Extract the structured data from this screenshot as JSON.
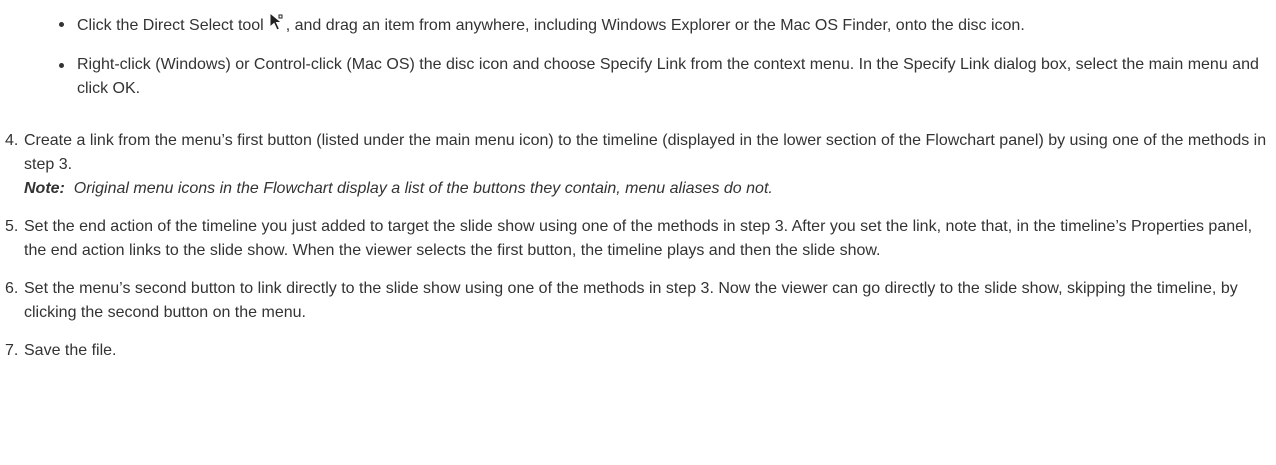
{
  "bullets": [
    {
      "text_before": "Click the Direct Select tool",
      "icon": "direct-select-cursor-icon",
      "text_after": ", and drag an item from anywhere, including Windows Explorer or the Mac OS Finder, onto the disc icon."
    },
    {
      "text": "Right-click (Windows) or Control-click (Mac OS) the disc icon and choose Specify Link from the context menu. In the Specify Link dialog box, select the main menu and click OK."
    }
  ],
  "steps": [
    {
      "number": "4.",
      "text": "Create a link from the menu’s first button (listed under the main menu icon) to the timeline (displayed in the lower section of the Flowchart panel) by using one of the methods in step 3.",
      "note_label": "Note:",
      "note_text": "Original menu icons in the Flowchart display a list of the buttons they contain, menu aliases do not."
    },
    {
      "number": "5.",
      "text": "Set the end action of the timeline you just added to target the slide show using one of the methods in step 3. After you set the link, note that, in the timeline’s Properties panel, the end action links to the slide show. When the viewer selects the first button, the timeline plays and then the slide show."
    },
    {
      "number": "6.",
      "text": "Set the menu’s second button to link directly to the slide show using one of the methods in step 3. Now the viewer can go directly to the slide show, skipping the timeline, by clicking the second button on the menu."
    },
    {
      "number": "7.",
      "text": "Save the file."
    }
  ]
}
